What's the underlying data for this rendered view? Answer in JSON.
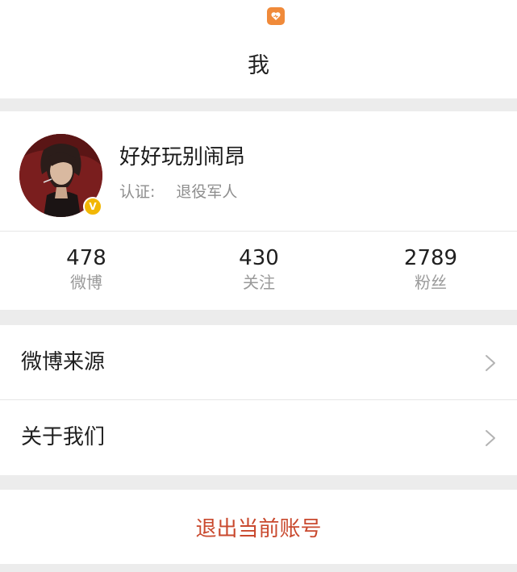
{
  "header": {
    "title": "我",
    "app_icon": "heart-chat-icon"
  },
  "profile": {
    "username": "好好玩别闹昂",
    "verify_label": "认证:",
    "verify_value": "退役军人",
    "verified_badge": "V",
    "avatar_icon": "avatar-image"
  },
  "stats": [
    {
      "count": "478",
      "label": "微博"
    },
    {
      "count": "430",
      "label": "关注"
    },
    {
      "count": "2789",
      "label": "粉丝"
    }
  ],
  "menu": [
    {
      "label": "微博来源",
      "icon": "chevron-right-icon"
    },
    {
      "label": "关于我们",
      "icon": "chevron-right-icon"
    }
  ],
  "logout": {
    "label": "退出当前账号"
  },
  "colors": {
    "accent": "#f08a3a",
    "logout_text": "#c9492e",
    "badge": "#f2b705",
    "background": "#ececec"
  }
}
